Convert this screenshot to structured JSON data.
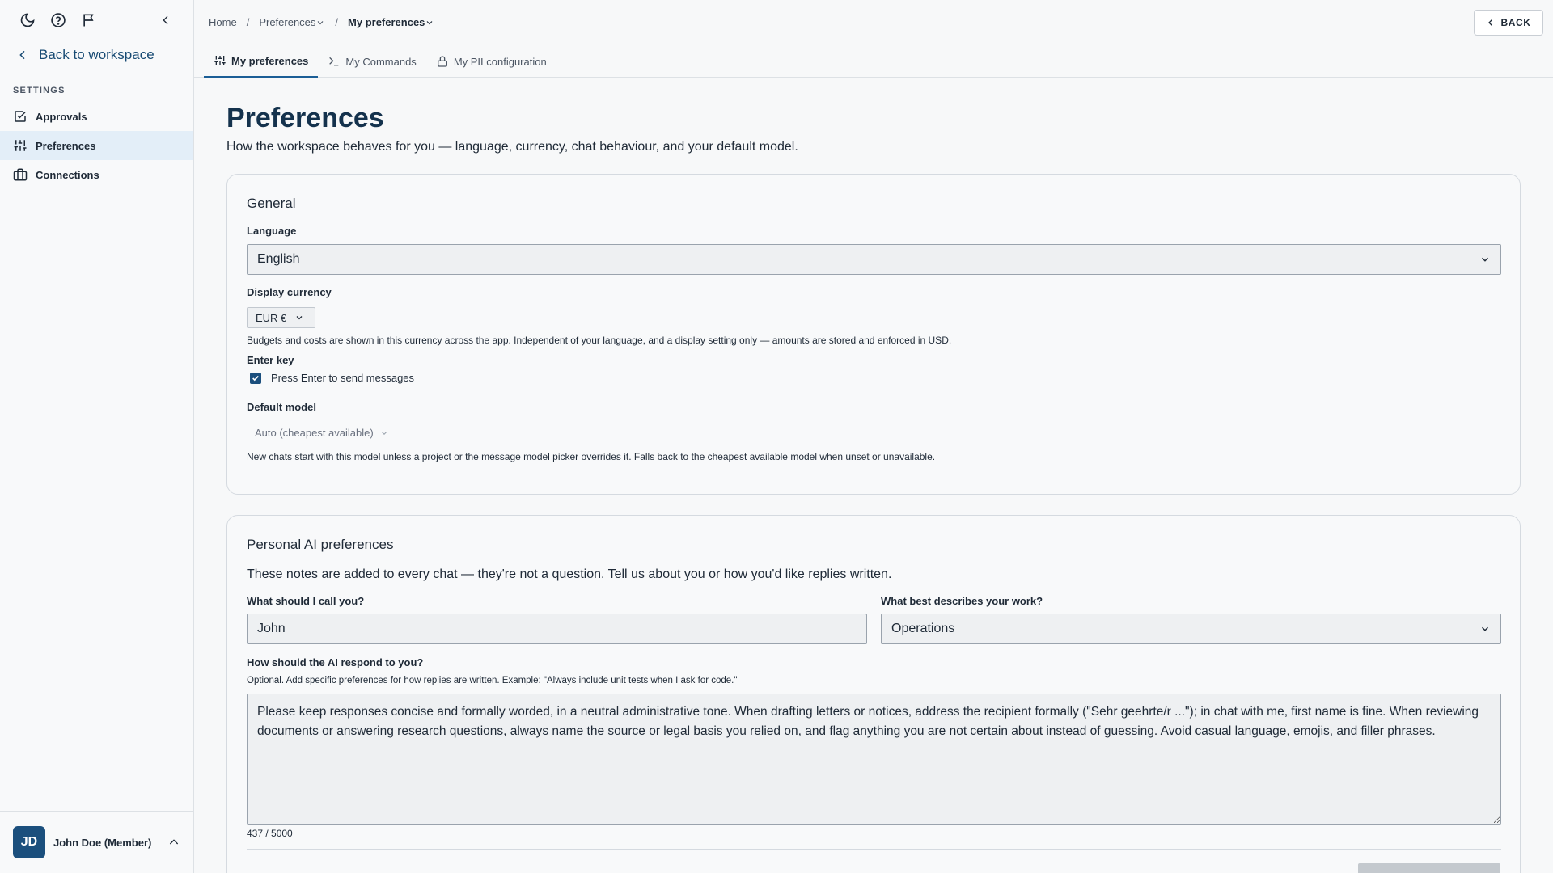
{
  "sidebar": {
    "back_label": "Back to workspace",
    "section_label": "SETTINGS",
    "items": [
      {
        "label": "Approvals",
        "icon": "check-square-icon"
      },
      {
        "label": "Preferences",
        "icon": "sliders-icon"
      },
      {
        "label": "Connections",
        "icon": "briefcase-icon"
      }
    ],
    "user": {
      "initials": "JD",
      "name": "John Doe (Member)"
    }
  },
  "header": {
    "breadcrumb": {
      "home": "Home",
      "section": "Preferences",
      "current": "My preferences"
    },
    "back_label": "BACK",
    "tabs": [
      {
        "label": "My preferences",
        "icon": "sliders-icon"
      },
      {
        "label": "My Commands",
        "icon": "terminal-icon"
      },
      {
        "label": "My PII configuration",
        "icon": "lock-icon"
      }
    ]
  },
  "main": {
    "title": "Preferences",
    "subtitle": "How the workspace behaves for you — language, currency, chat behaviour, and your default model.",
    "general": {
      "title": "General",
      "language_label": "Language",
      "language_value": "English",
      "currency_label": "Display currency",
      "currency_value": "EUR €",
      "currency_help": "Budgets and costs are shown in this currency across the app. Independent of your language, and a display setting only — amounts are stored and enforced in USD.",
      "enter_label": "Enter key",
      "enter_checkbox": "Press Enter to send messages",
      "model_label": "Default model",
      "model_value": "Auto (cheapest available)",
      "model_help": "New chats start with this model unless a project or the message model picker overrides it. Falls back to the cheapest available model when unset or unavailable."
    },
    "personal": {
      "title": "Personal AI preferences",
      "intro": "These notes are added to every chat — they're not a question. Tell us about you or how you'd like replies written.",
      "name_label": "What should I call you?",
      "name_value": "John",
      "work_label": "What best describes your work?",
      "work_value": "Operations",
      "respond_label": "How should the AI respond to you?",
      "respond_help": "Optional. Add specific preferences for how replies are written. Example: \"Always include unit tests when I ask for code.\"",
      "respond_value": "Please keep responses concise and formally worded, in a neutral administrative tone. When drafting letters or notices, address the recipient formally (\"Sehr geehrte/r ...\"); in chat with me, first name is fine. When reviewing documents or answering research questions, always name the source or legal basis you relied on, and flag anything you are not certain about instead of guessing. Avoid casual language, emojis, and filler phrases.",
      "counter": "437 / 5000"
    }
  },
  "colors": {
    "accent": "#1b4f7d",
    "active_nav_bg": "#e3eef8",
    "title": "#14324d"
  }
}
